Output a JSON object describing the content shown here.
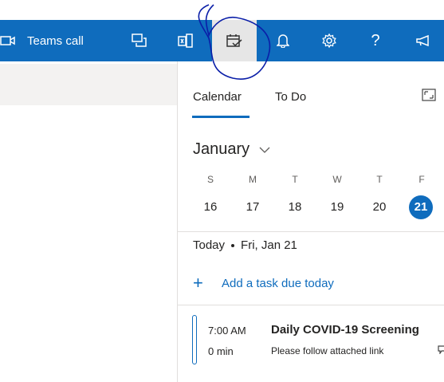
{
  "topbar": {
    "teams_call_label": "Teams call",
    "icons": [
      "video-icon",
      "chat-icon",
      "apps-icon",
      "calendar-check-icon",
      "bell-icon",
      "gear-icon",
      "help-icon",
      "megaphone-icon"
    ],
    "accent": "#0f6cbd"
  },
  "panel": {
    "tabs": [
      {
        "label": "Calendar",
        "active": true
      },
      {
        "label": "To Do",
        "active": false
      }
    ],
    "month_label": "January",
    "weekdays": [
      "S",
      "M",
      "T",
      "W",
      "T",
      "F"
    ],
    "days": [
      "16",
      "17",
      "18",
      "19",
      "20",
      "21"
    ],
    "today_index": 5,
    "today_label": "Today",
    "date_label": "Fri, Jan 21",
    "add_task_label": "Add a task due today",
    "event": {
      "time": "7:00 AM",
      "duration": "0 min",
      "title": "Daily COVID-19 Screening",
      "subtitle": "Please follow attached link"
    }
  }
}
